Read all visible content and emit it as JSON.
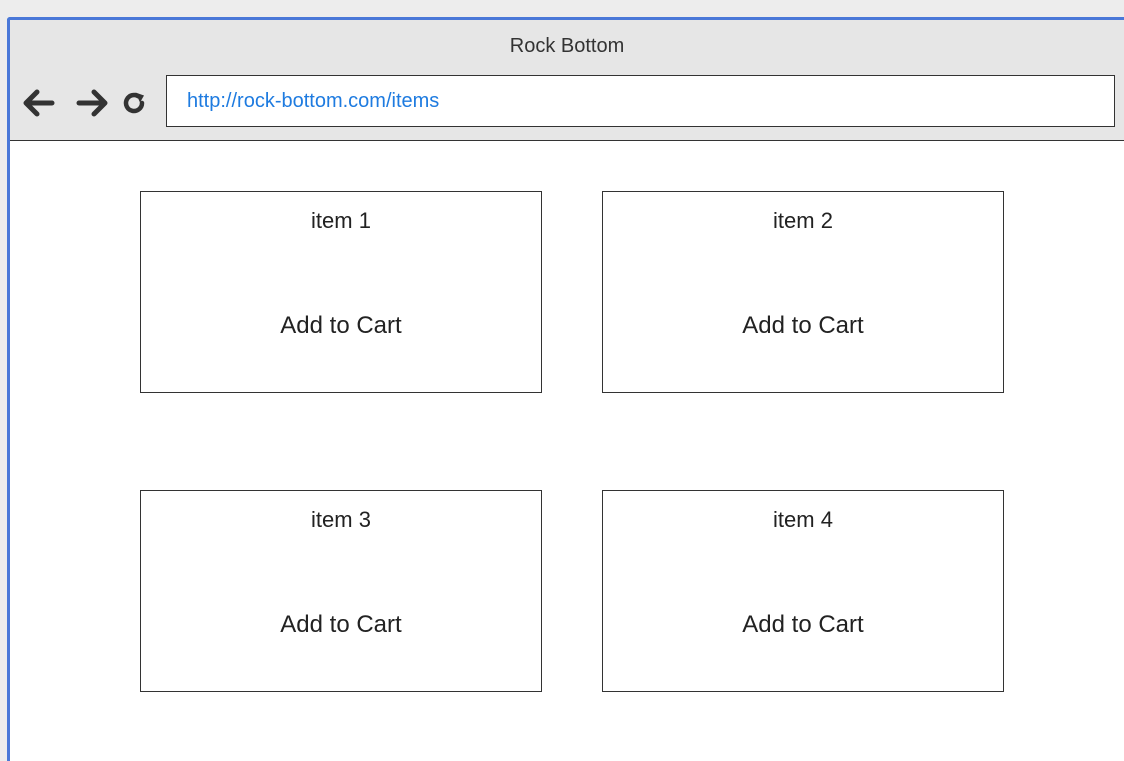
{
  "window": {
    "title": "Rock Bottom"
  },
  "toolbar": {
    "back_icon": "back-arrow-icon",
    "forward_icon": "forward-arrow-icon",
    "reload_icon": "reload-icon",
    "url": "http://rock-bottom.com/items"
  },
  "colors": {
    "accent_border": "#4a78d8",
    "url_text": "#1e7be0",
    "chrome_bg": "#e6e6e6"
  },
  "items": [
    {
      "title": "item 1",
      "button_label": "Add to Cart"
    },
    {
      "title": "item 2",
      "button_label": "Add to Cart"
    },
    {
      "title": "item 3",
      "button_label": "Add to Cart"
    },
    {
      "title": "item 4",
      "button_label": "Add to Cart"
    }
  ]
}
